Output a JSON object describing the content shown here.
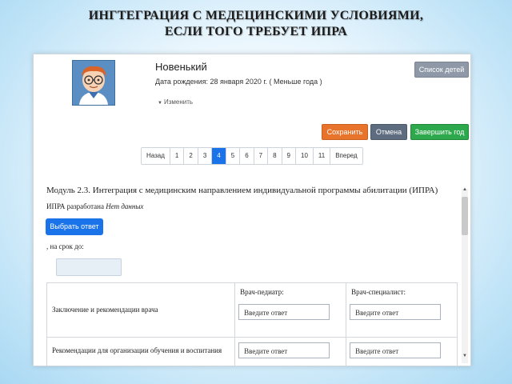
{
  "slide": {
    "title_line1": "ИНГТЕГРАЦИЯ С МЕДЕЦИНСКИМИ УСЛОВИЯМИ,",
    "title_line2": "ЕСЛИ ТОГО ТРЕБУЕТ ИПРА"
  },
  "child": {
    "name": "Новенький",
    "birth_date": "Дата рождения: 28 января 2020 г. ( Меньше года )",
    "edit_label": "Изменить"
  },
  "toolbar": {
    "children_list_label": "Список детей",
    "save_label": "Сохранить",
    "cancel_label": "Отмена",
    "finish_year_label": "Завершить год"
  },
  "pagination": {
    "prev_label": "Назад",
    "next_label": "Вперед",
    "pages": [
      "1",
      "2",
      "3",
      "4",
      "5",
      "6",
      "7",
      "8",
      "9",
      "10",
      "11"
    ],
    "active_page": "4"
  },
  "module": {
    "title": "Модуль 2.3. Интеграция с медицинским направлением индивидуальной программы абилитации (ИПРА)",
    "ipra_label": "ИПРА разработана",
    "ipra_value": "Нет данных",
    "choose_answer_label": "Выбрать ответ",
    "deadline_label": ", на срок до:"
  },
  "table": {
    "col_pediatrician": "Врач-педиатр:",
    "col_specialist": "Врач-специалист:",
    "rows": [
      {
        "label": "Заключение и рекомендации врача",
        "placeholder_1": "Введите ответ",
        "placeholder_2": "Введите ответ"
      },
      {
        "label": "Рекомендации для организации обучения и воспитания",
        "placeholder_1": "Введите ответ",
        "placeholder_2": "Введите ответ"
      }
    ]
  },
  "colors": {
    "primary": "#1a73e8",
    "save": "#e8742b",
    "cancel": "#5e6c80",
    "finish": "#2ea84c",
    "children_list": "#8e98a6"
  },
  "icons": [
    "child-avatar-icon",
    "caret-down-icon",
    "scroll-up-icon",
    "scroll-down-icon"
  ]
}
